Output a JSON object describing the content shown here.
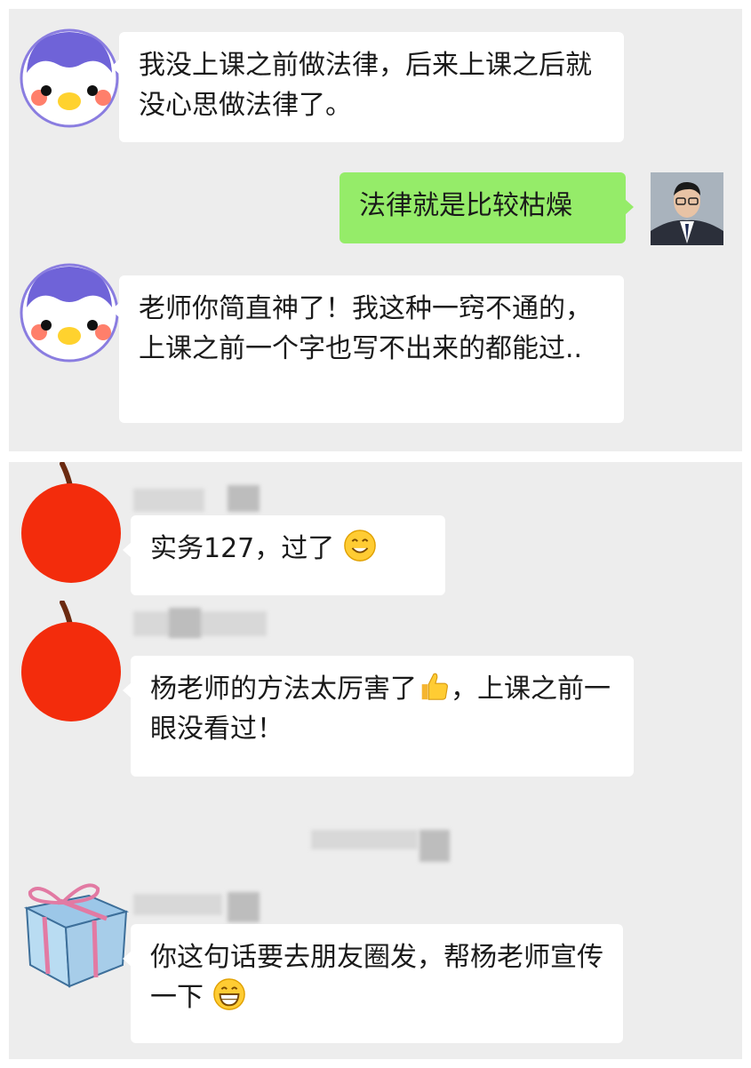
{
  "chat_1": {
    "messages": [
      {
        "sender": "penguin",
        "side": "left",
        "text": "我没上课之前做法律，后来上课之后就没心思做法律了。"
      },
      {
        "sender": "teacher",
        "side": "right",
        "text": "法律就是比较枯燥"
      },
      {
        "sender": "penguin",
        "side": "left",
        "text": "老师你简直神了！我这种一窍不通的，上课之前一个字也写不出来的都能过.."
      }
    ]
  },
  "chat_2": {
    "messages": [
      {
        "sender": "apple",
        "side": "left",
        "text": "实务127，过了",
        "emoji": "smile-emoji"
      },
      {
        "sender": "apple",
        "side": "left",
        "text_a": "杨老师的方法太厉害了",
        "emoji": "thumbs-up-emoji",
        "text_b": "，上课之前一眼没看过！"
      },
      {
        "sender": "gift-box",
        "side": "left",
        "text": "你这句话要去朋友圈发，帮杨老师宣传一下",
        "emoji": "grin-emoji"
      }
    ]
  },
  "colors": {
    "chat_background": "#ededed",
    "incoming_bubble": "#ffffff",
    "outgoing_bubble": "#95ec69",
    "text": "#1a1a1a"
  },
  "icons": [
    "penguin-avatar",
    "teacher-avatar",
    "apple-avatar",
    "gift-box-avatar",
    "smile-emoji",
    "thumbs-up-emoji",
    "grin-emoji"
  ]
}
